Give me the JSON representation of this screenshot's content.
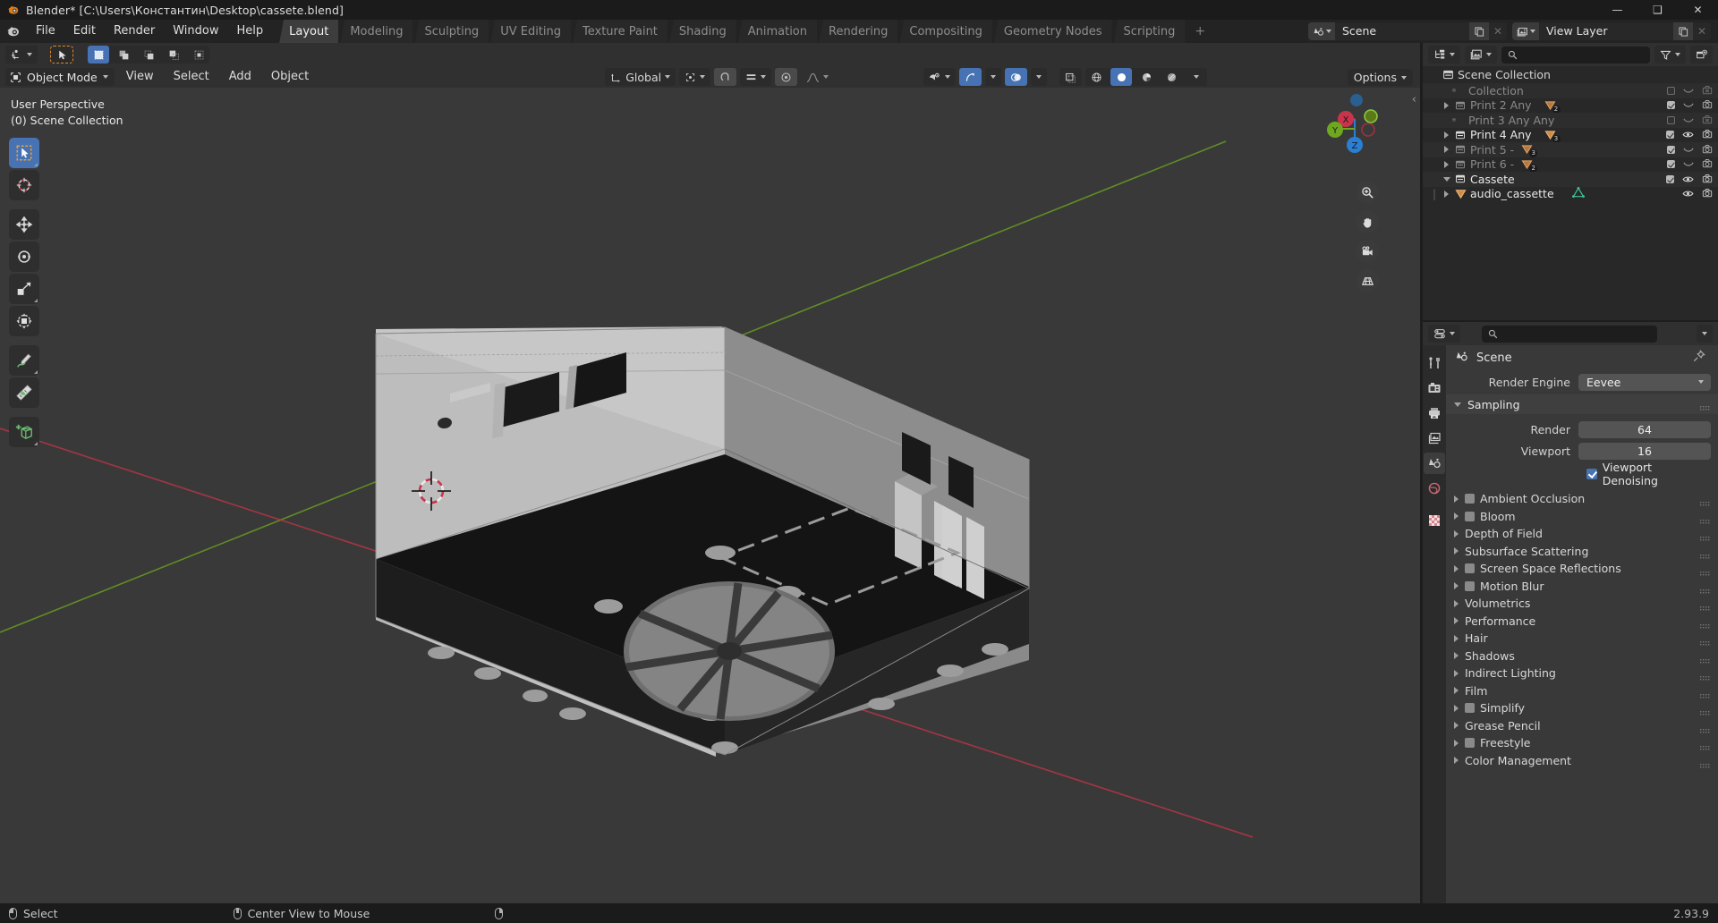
{
  "title_bar": {
    "app_title": "Blender* [C:\\Users\\Константин\\Desktop\\cassete.blend]",
    "minimize": "—",
    "maximize": "❑",
    "close": "✕"
  },
  "top_bar": {
    "menus": [
      "File",
      "Edit",
      "Render",
      "Window",
      "Help"
    ],
    "workspace_tabs": [
      {
        "label": "Layout",
        "active": true
      },
      {
        "label": "Modeling",
        "active": false
      },
      {
        "label": "Sculpting",
        "active": false
      },
      {
        "label": "UV Editing",
        "active": false
      },
      {
        "label": "Texture Paint",
        "active": false
      },
      {
        "label": "Shading",
        "active": false
      },
      {
        "label": "Animation",
        "active": false
      },
      {
        "label": "Rendering",
        "active": false
      },
      {
        "label": "Compositing",
        "active": false
      },
      {
        "label": "Geometry Nodes",
        "active": false
      },
      {
        "label": "Scripting",
        "active": false
      }
    ],
    "add_workspace": "+",
    "scene_name": "Scene",
    "view_layer_name": "View Layer"
  },
  "viewport": {
    "mode": "Object Mode",
    "menus": [
      "View",
      "Select",
      "Add",
      "Object"
    ],
    "transform_orientation": "Global",
    "options_label": "Options",
    "overlay_line1": "User Perspective",
    "overlay_line2": "(0) Scene Collection",
    "gizmo_axes": [
      "X",
      "Y",
      "Z"
    ],
    "tools": [
      "tweak-select-tool",
      "cursor-tool",
      "move-tool",
      "rotate-tool",
      "scale-tool",
      "transform-tool",
      "annotate-tool",
      "measure-tool",
      "add-cube-tool"
    ],
    "nav_buttons": [
      "zoom-icon",
      "pan-hand-icon",
      "camera-icon",
      "ortho-grid-icon"
    ]
  },
  "outliner": {
    "rows": [
      {
        "name": "Scene Collection",
        "indent": 0,
        "icon": "collection-icon",
        "disclosure": "none",
        "dim": false,
        "checkbox": null,
        "eye": "none",
        "camera": "none",
        "badge": null,
        "highlight": false
      },
      {
        "name": "Collection",
        "indent": 1,
        "icon": "collection-icon",
        "disclosure": "none",
        "dim": true,
        "checkbox": false,
        "eye": "closed",
        "camera": "off",
        "badge": null,
        "highlight": false
      },
      {
        "name": "Print 2 Any",
        "indent": 1,
        "icon": "collection-icon",
        "disclosure": "closed",
        "dim": true,
        "checkbox": true,
        "eye": "closed",
        "camera": "on",
        "badge": "2",
        "highlight": false
      },
      {
        "name": "Print 3 Any Any",
        "indent": 1,
        "icon": "collection-icon",
        "disclosure": "none",
        "dim": true,
        "checkbox": false,
        "eye": "closed",
        "camera": "off",
        "badge": null,
        "highlight": false
      },
      {
        "name": "Print 4 Any",
        "indent": 1,
        "icon": "collection-icon",
        "disclosure": "closed",
        "dim": false,
        "checkbox": true,
        "eye": "open",
        "camera": "on",
        "badge": "3",
        "highlight": false
      },
      {
        "name": "Print 5 -",
        "indent": 1,
        "icon": "collection-icon",
        "disclosure": "closed",
        "dim": true,
        "checkbox": true,
        "eye": "closed",
        "camera": "on",
        "badge": "3",
        "highlight": false
      },
      {
        "name": "Print 6 -",
        "indent": 1,
        "icon": "collection-icon",
        "disclosure": "closed",
        "dim": true,
        "checkbox": true,
        "eye": "closed",
        "camera": "on",
        "badge": "2",
        "highlight": false
      },
      {
        "name": "Cassete",
        "indent": 1,
        "icon": "collection-icon",
        "disclosure": "open",
        "dim": false,
        "checkbox": true,
        "eye": "open",
        "camera": "on",
        "badge": null,
        "highlight": false
      },
      {
        "name": "audio_cassette",
        "indent": 2,
        "icon": "mesh-object-icon",
        "disclosure": "closed",
        "dim": false,
        "checkbox": null,
        "eye": "open",
        "camera": "on",
        "badge": null,
        "highlight": false,
        "data_icon": "mesh-data-icon"
      }
    ]
  },
  "properties": {
    "tabs": [
      "tool-icon",
      "render-icon",
      "output-icon",
      "view-layer-icon",
      "scene-icon",
      "world-icon",
      "texture-icon"
    ],
    "breadcrumb": "Scene",
    "render_engine_label": "Render Engine",
    "render_engine_value": "Eevee",
    "sampling_label": "Sampling",
    "sampling_fields": [
      {
        "label": "Render",
        "value": "64"
      },
      {
        "label": "Viewport",
        "value": "16"
      }
    ],
    "viewport_denoising_label": "Viewport Denoising",
    "viewport_denoising_checked": true,
    "panels": [
      {
        "label": "Ambient Occlusion",
        "checkbox": true
      },
      {
        "label": "Bloom",
        "checkbox": true
      },
      {
        "label": "Depth of Field",
        "checkbox": false
      },
      {
        "label": "Subsurface Scattering",
        "checkbox": false
      },
      {
        "label": "Screen Space Reflections",
        "checkbox": true
      },
      {
        "label": "Motion Blur",
        "checkbox": true
      },
      {
        "label": "Volumetrics",
        "checkbox": false
      },
      {
        "label": "Performance",
        "checkbox": false
      },
      {
        "label": "Hair",
        "checkbox": false
      },
      {
        "label": "Shadows",
        "checkbox": false
      },
      {
        "label": "Indirect Lighting",
        "checkbox": false
      },
      {
        "label": "Film",
        "checkbox": false
      },
      {
        "label": "Simplify",
        "checkbox": true
      },
      {
        "label": "Grease Pencil",
        "checkbox": false
      },
      {
        "label": "Freestyle",
        "checkbox": true
      },
      {
        "label": "Color Management",
        "checkbox": false
      }
    ]
  },
  "status_bar": {
    "items": [
      {
        "mouse": "left",
        "label": "Select"
      },
      {
        "mouse": "middle",
        "label": "Center View to Mouse"
      },
      {
        "mouse": "right",
        "label": ""
      }
    ],
    "version": "2.93.9"
  },
  "colors": {
    "accent_blue": "#4772b3",
    "axis_x_red": "#c9344a",
    "axis_y_green": "#6fa81f",
    "axis_z_blue": "#2a7fd4",
    "collection_orange": "#e8a05a"
  }
}
